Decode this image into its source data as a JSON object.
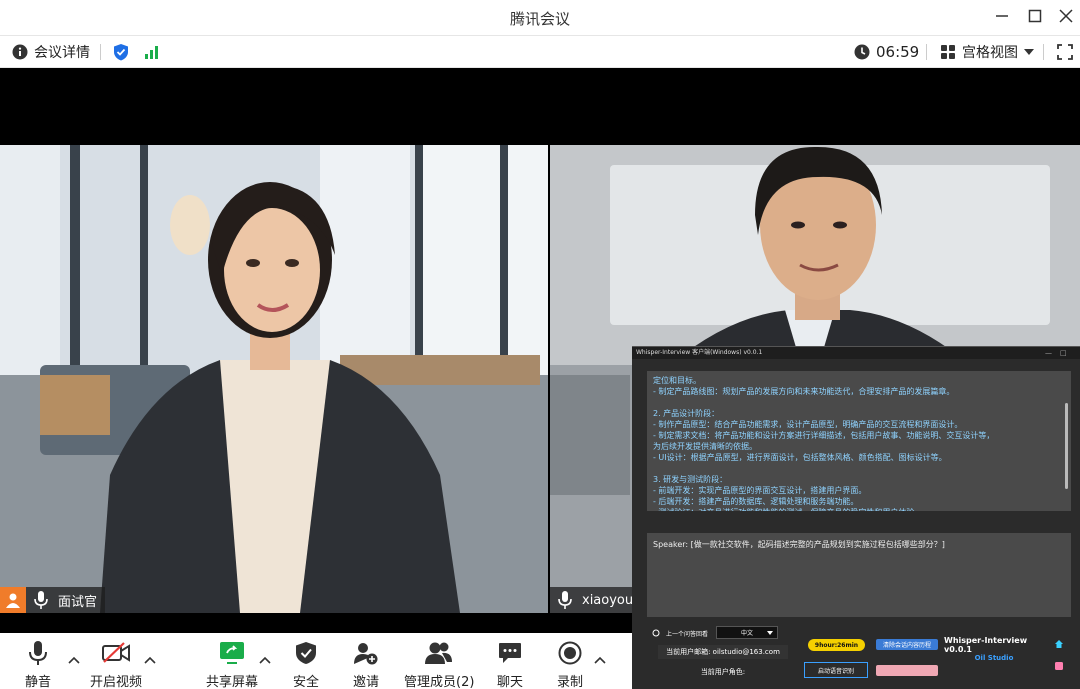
{
  "window": {
    "title": "腾讯会议",
    "minimize_icon": "minimize-icon",
    "maximize_icon": "maximize-icon",
    "close_icon": "close-icon"
  },
  "infobar": {
    "details_label": "会议详情",
    "timer": "06:59",
    "view_label": "宫格视图"
  },
  "participants": [
    {
      "name": "面试官"
    },
    {
      "name": "xiaoyou"
    }
  ],
  "helper": {
    "title": "Whisper-Interview 客户端(Windows) v0.0.1",
    "lines": [
      "定位和目标。",
      "  - 制定产品路线图：规划产品的发展方向和未来功能迭代，合理安排产品的发展篇章。",
      "",
      "2. 产品设计阶段：",
      "  - 制作产品原型：结合产品功能需求，设计产品原型，明确产品的交互流程和界面设计。",
      "  - 制定需求文档：将产品功能和设计方案进行详细描述，包括用户故事、功能说明、交互设计等，",
      "为后续开发提供清晰的依据。",
      "  - UI设计：根据产品原型，进行界面设计，包括整体风格、颜色搭配、图标设计等。",
      "",
      "3. 研发与测试阶段：",
      "  - 前端开发：实现产品原型的界面交互设计，搭建用户界面。",
      "  - 后端开发：搭建产品的数据库、逻辑处理和服务端功能。",
      "  - 测试验证：对产品进行功能和性能的测试，保障产品的稳定性和用户体验。"
    ],
    "speaker_text": "Speaker: [做一款社交软件，起码描述完整的产品规划到实施过程包括哪些部分？]",
    "prev_question": "上一个问答回看",
    "language": "中文",
    "user_email": "当前用户邮箱: oilstudio@163.com",
    "user_role": "当前用户角色:",
    "timer_badge": "9hour:26min",
    "voice_button": "清除会话内容历程",
    "start_button": "启动语音识别",
    "brand": "Whisper-Interview v0.0.1",
    "studio": "Oil Studio",
    "colors": {
      "timer_bg": "#f5d000",
      "blue_btn": "#3a7bd5",
      "pink_btn": "#f0a8b4",
      "brand": "#ffffff",
      "studio": "#3aa0ff"
    }
  },
  "toolbar": {
    "items": [
      {
        "label": "静音",
        "icon": "mic-icon"
      },
      {
        "label": "开启视频",
        "icon": "camera-off-icon"
      },
      {
        "label": "共享屏幕",
        "icon": "share-screen-icon"
      },
      {
        "label": "安全",
        "icon": "shield-icon"
      },
      {
        "label": "邀请",
        "icon": "invite-icon"
      },
      {
        "label": "管理成员(2)",
        "icon": "members-icon"
      },
      {
        "label": "聊天",
        "icon": "chat-icon"
      },
      {
        "label": "录制",
        "icon": "record-icon"
      }
    ]
  },
  "colors": {
    "share_green": "#1aad4a",
    "signal_green": "#1aad4a",
    "shield_blue": "#1f6fe5",
    "accent_orange": "#f07c2a"
  }
}
